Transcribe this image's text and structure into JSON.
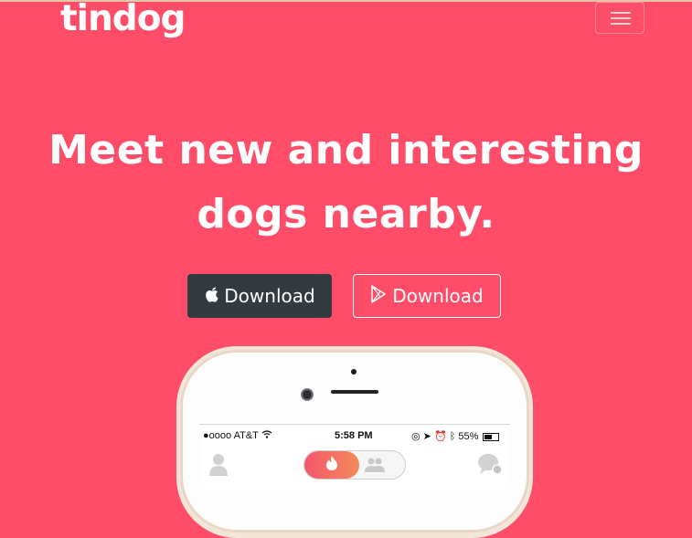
{
  "navbar": {
    "brand": "tindog",
    "menu_icon": "hamburger-menu-icon"
  },
  "hero": {
    "headline_line1": "Meet new and interesting",
    "headline_line2": "dogs nearby.",
    "download_apple_label": "Download",
    "download_apple_icon": "apple-icon",
    "download_google_label": "Download",
    "download_google_icon": "google-play-icon"
  },
  "phone": {
    "status": {
      "carrier": "●oooo AT&T",
      "time": "5:58 PM",
      "battery": "55%"
    },
    "appbar": {
      "left_icon": "profile-icon",
      "active_tab_icon": "flame-icon",
      "inactive_tab_icon": "group-icon",
      "right_icon": "chat-icon"
    }
  },
  "colors": {
    "background": "#ff4c68",
    "dark_button": "#333a40",
    "text": "#ffffff"
  }
}
